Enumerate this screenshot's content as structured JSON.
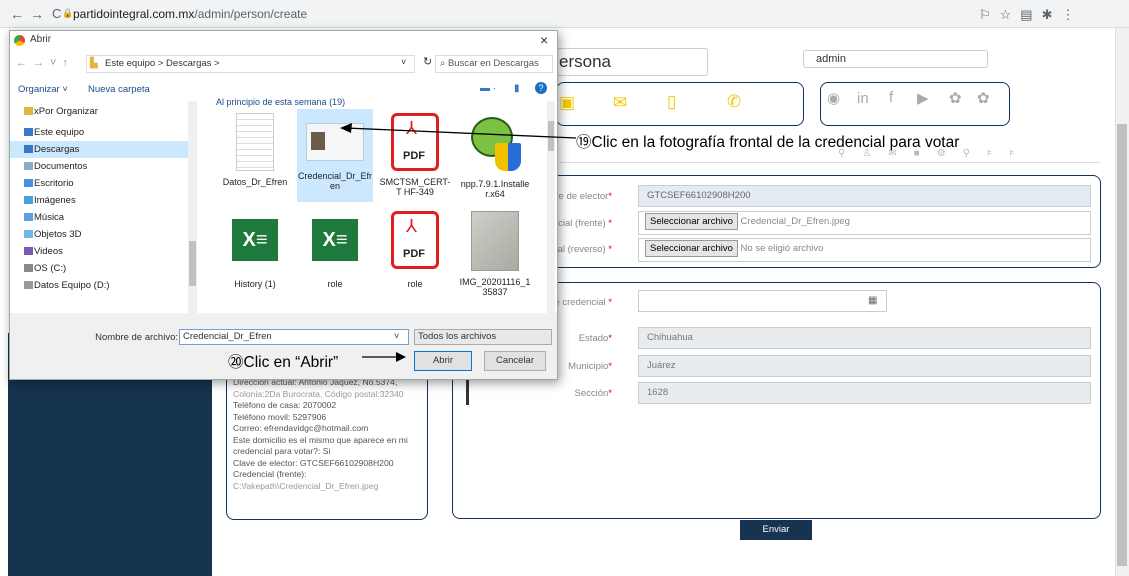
{
  "browser": {
    "back": "←",
    "forward": "→",
    "reload": "C",
    "url_domain": "partidointegral.com.mx",
    "url_path": "/admin/person/create"
  },
  "page": {
    "heading": "ersona",
    "user_field": "admin",
    "contact_icons": [
      "box",
      "mail",
      "phone",
      "call"
    ],
    "social_icons": [
      "google",
      "in",
      "f",
      "youtube",
      "gear",
      "gear"
    ],
    "form1": {
      "elector_label": "ve de elector",
      "elector_value": "GTCSEF66102908H200",
      "front_label": "ncial (frente)",
      "front_button": "Seleccionar archivo",
      "front_file": "Credencial_Dr_Efren.jpeg",
      "back_label": "cial (reverso)",
      "back_button": "Seleccionar archivo",
      "back_file": "No se eligió archivo"
    },
    "form2": {
      "cred_label": "e credencial",
      "estado_label": "Estado",
      "estado_value": "Chihuahua",
      "municipio_label": "Municipio",
      "municipio_value": "Juárez",
      "seccion_label": "Sección",
      "seccion_value": "1628"
    },
    "summary": [
      "Dirección actual: Antonio Jaquez, No.5374,",
      "Colonia:2Da Burocrata, Código postal:32340",
      "Teléfono de casa: 2070002",
      "Teléfono movil: 5297906",
      "Correo: efrendavidgc@hotmail.com",
      "Este domicilio es el mismo que aparece en mi",
      "credencial para votar?: Si",
      "Clave de elector: GTCSEF66102908H200",
      "Credencial (frente):",
      "C:\\fakepath\\Credencial_Dr_Efren.jpeg"
    ],
    "submit": "Enviar",
    "required_mark": "*"
  },
  "dialog": {
    "title": "Abrir",
    "close": "×",
    "breadcrumb": "Este equipo  >  Descargas  >",
    "search_placeholder": "Buscar en Descargas",
    "organize": "Organizar ˅",
    "new_folder": "Nueva carpeta",
    "group_header": "Al principio de esta semana (19)",
    "tree": [
      {
        "label": "xPor Organizar",
        "color": "#e2b540"
      },
      {
        "label": "Este equipo",
        "color": "#3a78c4"
      },
      {
        "label": "Descargas",
        "color": "#3a78c4",
        "selected": true
      },
      {
        "label": "Documentos",
        "color": "#8da9c9"
      },
      {
        "label": "Escritorio",
        "color": "#4a90e2"
      },
      {
        "label": "Imágenes",
        "color": "#4aa1d8"
      },
      {
        "label": "Música",
        "color": "#5b9fde"
      },
      {
        "label": "Objetos 3D",
        "color": "#6fb7e6"
      },
      {
        "label": "Videos",
        "color": "#7a5bb5"
      },
      {
        "label": "OS (C:)",
        "color": "#888"
      },
      {
        "label": "Datos Equipo (D:)",
        "color": "#999"
      }
    ],
    "files": [
      {
        "name": "Datos_Dr_Efren",
        "kind": "doc"
      },
      {
        "name": "Credencial_Dr_Efr en",
        "kind": "id",
        "selected": true
      },
      {
        "name": "SMCTSM_CERT-T HF-349",
        "kind": "pdf"
      },
      {
        "name": "npp.7.9.1.Installe r.x64",
        "kind": "npp"
      },
      {
        "name": "History (1)",
        "kind": "xls"
      },
      {
        "name": "role",
        "kind": "xls"
      },
      {
        "name": "role",
        "kind": "pdf"
      },
      {
        "name": "IMG_20201116_1 35837",
        "kind": "img"
      }
    ],
    "pdf_text": "PDF",
    "filename_label": "Nombre de archivo:",
    "filename_value": "Credencial_Dr_Efren",
    "filter": "Todos los archivos",
    "open": "Abrir",
    "cancel": "Cancelar"
  },
  "annotations": {
    "step19": "⑲Clic en la fotografía frontal de la credencial para votar",
    "step20": "⑳Clic en “Abrir”"
  }
}
